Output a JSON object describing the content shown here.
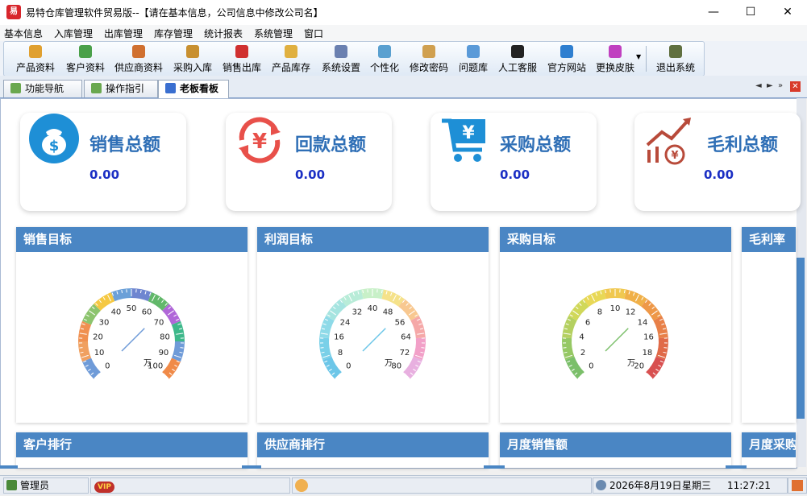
{
  "window": {
    "title": "易特仓库管理软件贸易版--【请在基本信息，公司信息中修改公司名】",
    "app_icon_text": "易",
    "minimize": "—",
    "maximize": "☐",
    "close": "✕"
  },
  "menu": [
    "基本信息",
    "入库管理",
    "出库管理",
    "库存管理",
    "统计报表",
    "系统管理",
    "窗口"
  ],
  "toolbar": [
    {
      "label": "产品资料",
      "icon": "product-icon",
      "color": "#e0a030"
    },
    {
      "label": "客户资料",
      "icon": "customer-icon",
      "color": "#4aa04a"
    },
    {
      "label": "供应商资料",
      "icon": "supplier-icon",
      "color": "#d07030"
    },
    {
      "label": "采购入库",
      "icon": "purchase-in-icon",
      "color": "#c89030"
    },
    {
      "label": "销售出库",
      "icon": "sales-out-icon",
      "color": "#d03030"
    },
    {
      "label": "产品库存",
      "icon": "inventory-icon",
      "color": "#e0b040"
    },
    {
      "label": "系统设置",
      "icon": "settings-icon",
      "color": "#6a80b0"
    },
    {
      "label": "个性化",
      "icon": "personalize-icon",
      "color": "#5aa0d0"
    },
    {
      "label": "修改密码",
      "icon": "password-icon",
      "color": "#d0a050"
    },
    {
      "label": "问题库",
      "icon": "faq-icon",
      "color": "#5a9ad8"
    },
    {
      "label": "人工客服",
      "icon": "qq-icon",
      "color": "#222222"
    },
    {
      "label": "官方网站",
      "icon": "ie-icon",
      "color": "#2f7fd0"
    },
    {
      "label": "更换皮肤",
      "icon": "skin-icon",
      "color": "#c040c0"
    },
    {
      "label": "退出系统",
      "icon": "exit-icon",
      "color": "#607040"
    }
  ],
  "tabs": [
    {
      "label": "功能导航",
      "active": false
    },
    {
      "label": "操作指引",
      "active": false
    },
    {
      "label": "老板看板",
      "active": true
    }
  ],
  "kpis": [
    {
      "title": "销售总额",
      "value": "0.00",
      "icon": "money-bag-icon",
      "color": "#1e8fd6"
    },
    {
      "title": "回款总额",
      "value": "0.00",
      "icon": "yuan-refresh-icon",
      "color": "#e8504a"
    },
    {
      "title": "采购总额",
      "value": "0.00",
      "icon": "shopping-cart-icon",
      "color": "#1e8fd6"
    },
    {
      "title": "毛利总额",
      "value": "0.00",
      "icon": "profit-chart-icon",
      "color": "#b84a3a"
    }
  ],
  "panels": [
    "销售目标",
    "利润目标",
    "采购目标",
    "毛利率"
  ],
  "panels_bottom": [
    "客户排行",
    "供应商排行",
    "月度销售额",
    "月度采购"
  ],
  "gauges": [
    {
      "unit": "万",
      "min": 0,
      "max": 100,
      "labels": [
        "0",
        "10",
        "20",
        "30",
        "40",
        "50",
        "60",
        "70",
        "80",
        "90",
        "100"
      ],
      "value": 0,
      "colors": [
        "#6f9bd8",
        "#f0a060",
        "#f09050",
        "#8cc46e",
        "#f5c842",
        "#6aa0d8",
        "#6f86d0",
        "#62b86a",
        "#b067d8",
        "#3db88a",
        "#6f9bd8",
        "#f08a48"
      ]
    },
    {
      "unit": "万",
      "min": 0,
      "max": 80,
      "labels": [
        "0",
        "8",
        "16",
        "24",
        "32",
        "40",
        "48",
        "56",
        "64",
        "72",
        "80"
      ],
      "value": 0,
      "colors": [
        "#6cc6e8",
        "#7ad0e8",
        "#8edae8",
        "#a6e4e0",
        "#b8ecd8",
        "#c8f0c8",
        "#f5e28a",
        "#f8c890",
        "#f5a8a8",
        "#f2a0c8",
        "#e8b0e0"
      ]
    },
    {
      "unit": "万",
      "min": 0,
      "max": 20,
      "labels": [
        "0",
        "2",
        "4",
        "6",
        "8",
        "10",
        "12",
        "14",
        "16",
        "18",
        "20"
      ],
      "value": 0,
      "colors": [
        "#7bbf6a",
        "#96c864",
        "#b4d060",
        "#d0d85a",
        "#e8d856",
        "#f0c850",
        "#f0b048",
        "#ee9848",
        "#e88048",
        "#e06a48",
        "#d85050"
      ]
    }
  ],
  "status": {
    "user": "管理员",
    "vip": "VIP",
    "date": "2026年8月19日",
    "weekday": "星期三",
    "time": "11:27:21"
  }
}
